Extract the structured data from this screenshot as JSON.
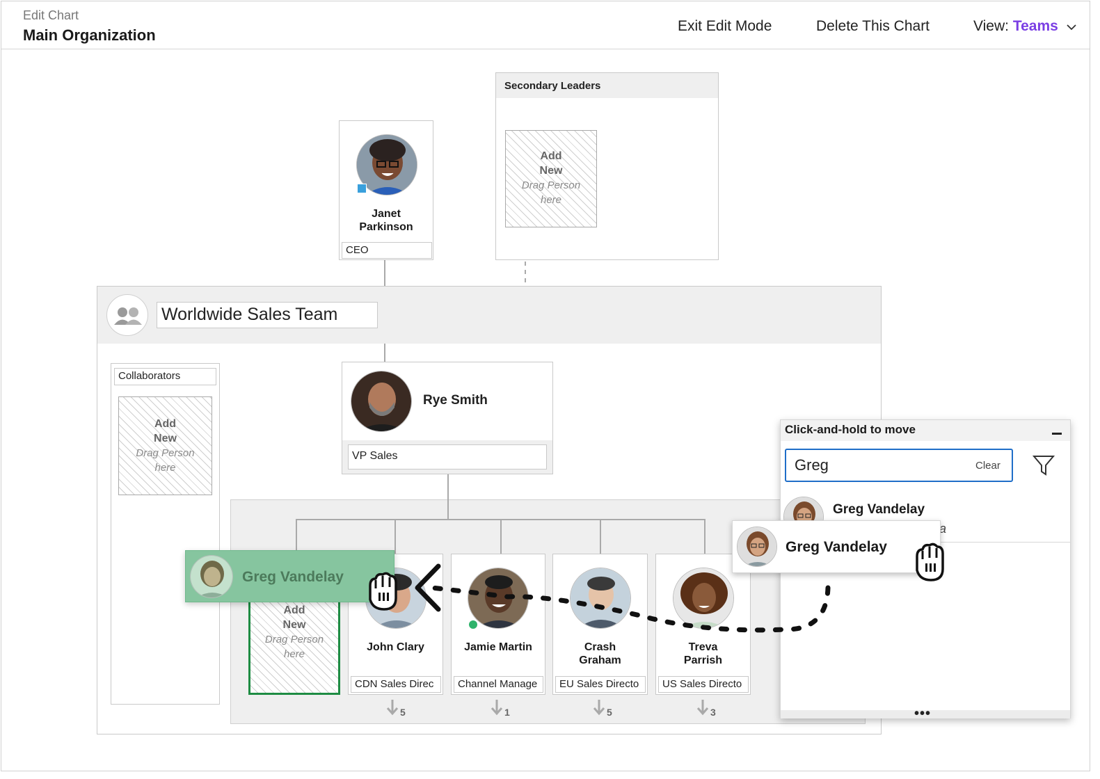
{
  "header": {
    "subtitle": "Edit Chart",
    "title": "Main Organization",
    "exit_label": "Exit Edit Mode",
    "delete_label": "Delete This Chart",
    "view_prefix": "View:",
    "view_value": "Teams"
  },
  "ceo": {
    "name_line1": "Janet",
    "name_line2": "Parkinson",
    "role": "CEO",
    "status_color": "#3aa0dc"
  },
  "secondary": {
    "title": "Secondary Leaders",
    "placeholder_line1": "Add",
    "placeholder_line2": "New",
    "placeholder_line3": "Drag Person",
    "placeholder_line4": "here"
  },
  "team": {
    "name": "Worldwide Sales Team"
  },
  "collaborators": {
    "label": "Collaborators",
    "placeholder_line1": "Add",
    "placeholder_line2": "New",
    "placeholder_line3": "Drag Person",
    "placeholder_line4": "here"
  },
  "vp": {
    "name": "Rye Smith",
    "role": "VP Sales"
  },
  "drop_target": {
    "line1": "Add",
    "line2": "New",
    "line3": "Drag Person",
    "line4": "here",
    "highlight_color": "#1e8c43"
  },
  "reports": [
    {
      "name_line1": "John Clary",
      "name_line2": "",
      "role": "CDN Sales Direc",
      "count": "5"
    },
    {
      "name_line1": "Jamie Martin",
      "name_line2": "",
      "role": "Channel Manage",
      "count": "1",
      "status_color": "#2fb36b"
    },
    {
      "name_line1": "Crash",
      "name_line2": "Graham",
      "role": "EU Sales Directo",
      "count": "5"
    },
    {
      "name_line1": "Treva",
      "name_line2": "Parrish",
      "role": "US Sales Directo",
      "count": "3"
    }
  ],
  "panel": {
    "title": "Click-and-hold to move",
    "search_value": "Greg",
    "clear_label": "Clear",
    "result_name": "Greg Vandelay",
    "result_sub_fragment": "a",
    "more": "•••"
  },
  "drag": {
    "ghost_name": "Greg Vandelay",
    "target_name": "Greg Vandelay"
  },
  "colors": {
    "accent": "#7b3fe4",
    "search_border": "#1f6ec8",
    "ghost_fill": "#86c59f"
  },
  "icons": [
    "chevron-down-icon",
    "team-icon",
    "filter-icon",
    "minimize-icon",
    "grab-hand-icon",
    "reports-arrow-icon",
    "more-icon"
  ]
}
